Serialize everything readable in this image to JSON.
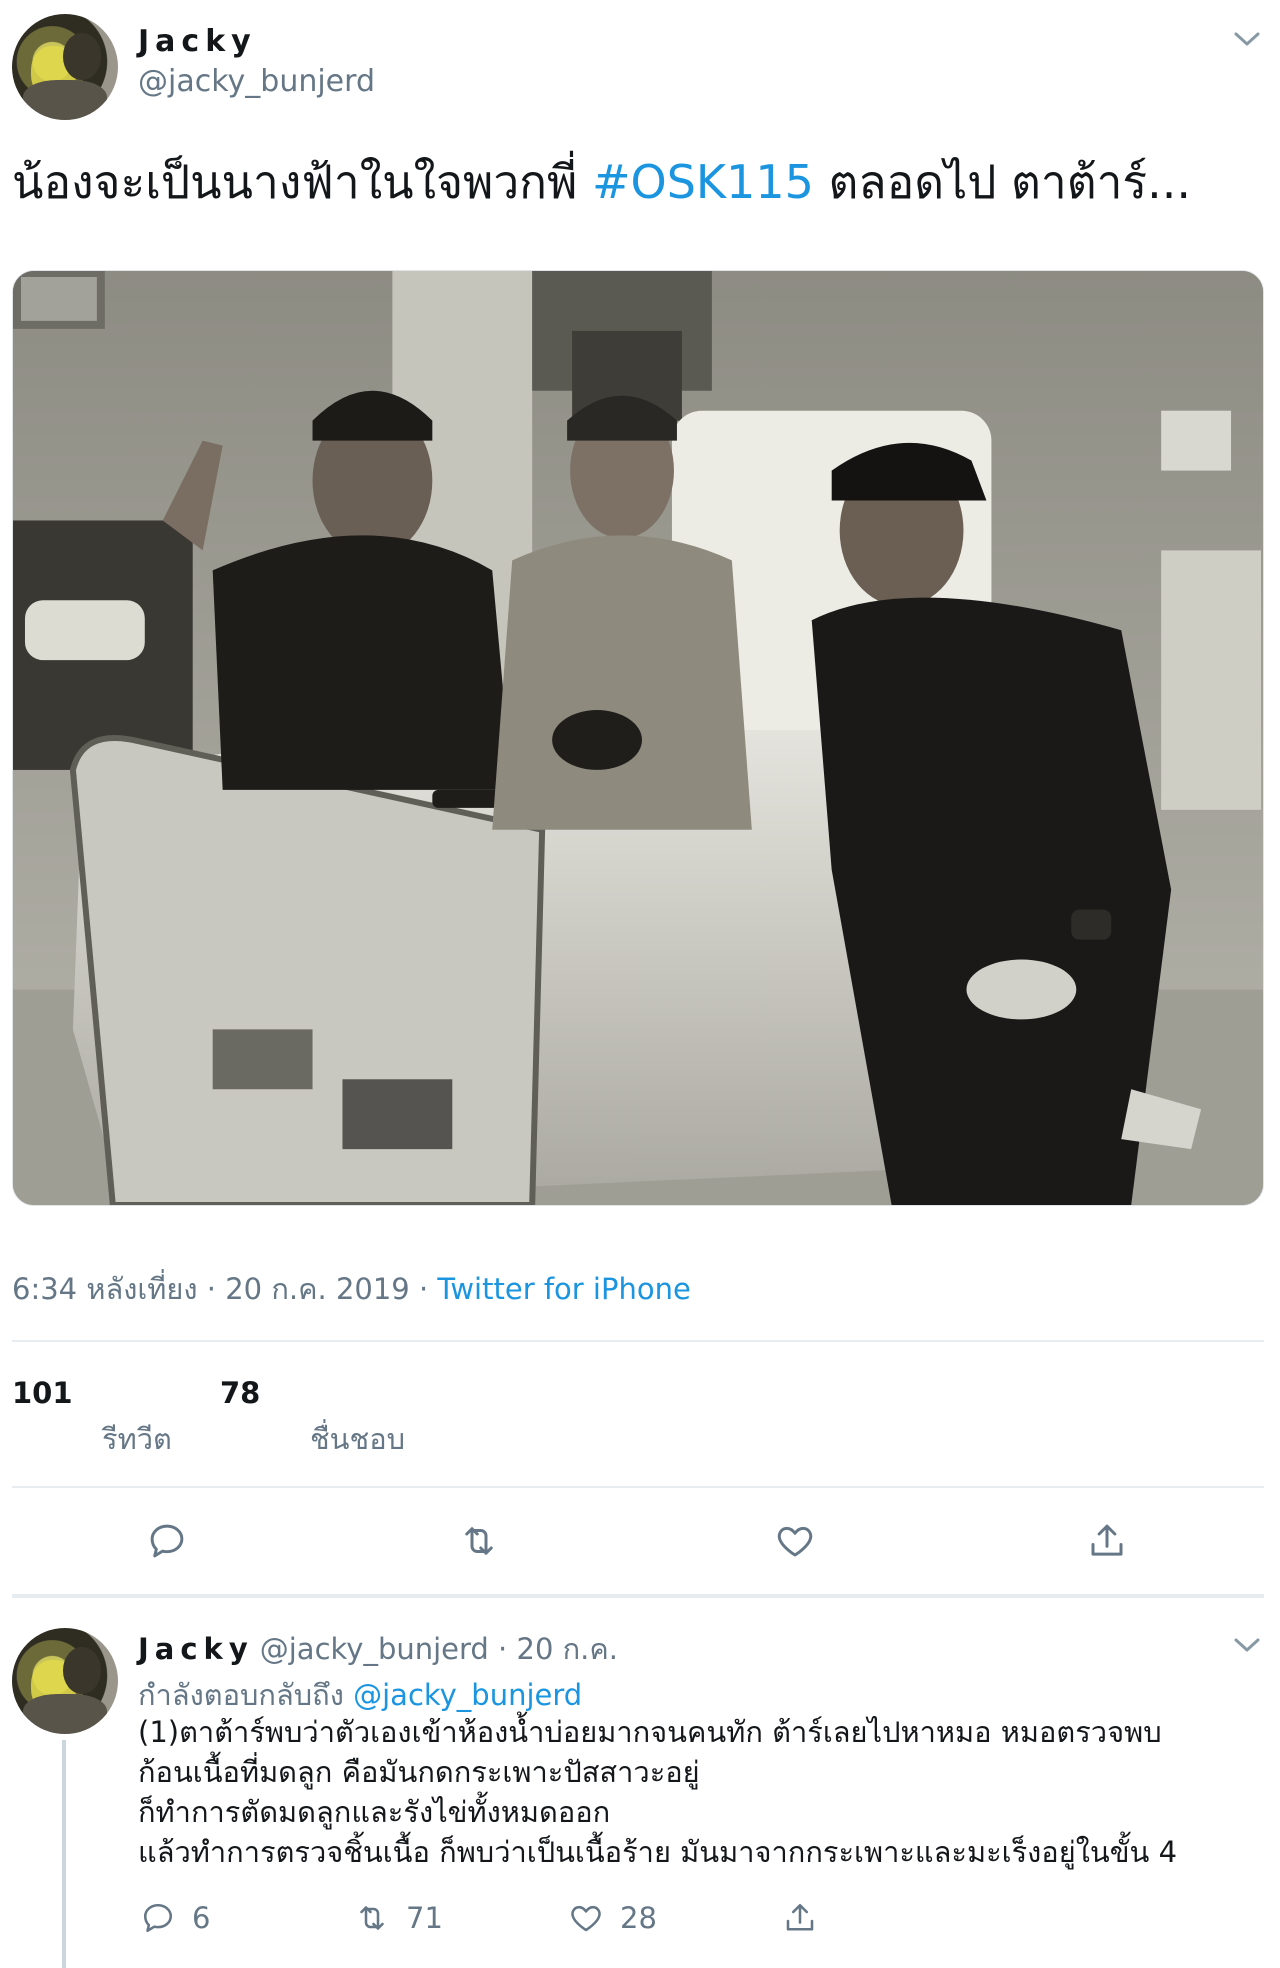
{
  "tweet": {
    "display_name": "Jacky",
    "handle": "@jacky_bunjerd",
    "text_before": "น้องจะเป็นนางฟ้าในใจพวกพี่ ",
    "hashtag": "#OSK115",
    "text_after": " ตลอดไป ตาต้าร์...",
    "photo_icon": "photo-image",
    "timestamp": "6:34 หลังเที่ยง · 20 ก.ค. 2019 · ",
    "source": "Twitter for iPhone",
    "retweets": "101",
    "retweets_label": "รีทวีต",
    "likes": "78",
    "likes_label": "ชื่นชอบ"
  },
  "actions": {
    "reply_icon": "reply-icon",
    "retweet_icon": "retweet-icon",
    "like_icon": "heart-icon",
    "share_icon": "share-icon"
  },
  "reply": {
    "display_name": "Jacky",
    "handle_date": "@jacky_bunjerd · 20 ก.ค.",
    "replying_prefix": "กำลังตอบกลับถึง ",
    "replying_mention": "@jacky_bunjerd",
    "lines": [
      "(1)ตาต้าร์พบว่าตัวเองเข้าห้องน้ำบ่อยมากจนคนทัก ต้าร์เลยไปหาหมอ หมอตรวจพบ",
      "ก้อนเนื้อที่มดลูก คือมันกดกระเพาะปัสสาวะอยู่",
      "ก็ทำการตัดมดลูกและรังไข่ทั้งหมดออก",
      "แล้วทำการตรวจชิ้นเนื้อ ก็พบว่าเป็นเนื้อร้าย มันมาจากกระเพาะและมะเร็งอยู่ในขั้น 4"
    ],
    "reply_count": "6",
    "retweet_count": "71",
    "like_count": "28"
  },
  "colors": {
    "link": "#1b95e0",
    "secondary_text": "#657786",
    "divider": "#e6ecf0"
  }
}
